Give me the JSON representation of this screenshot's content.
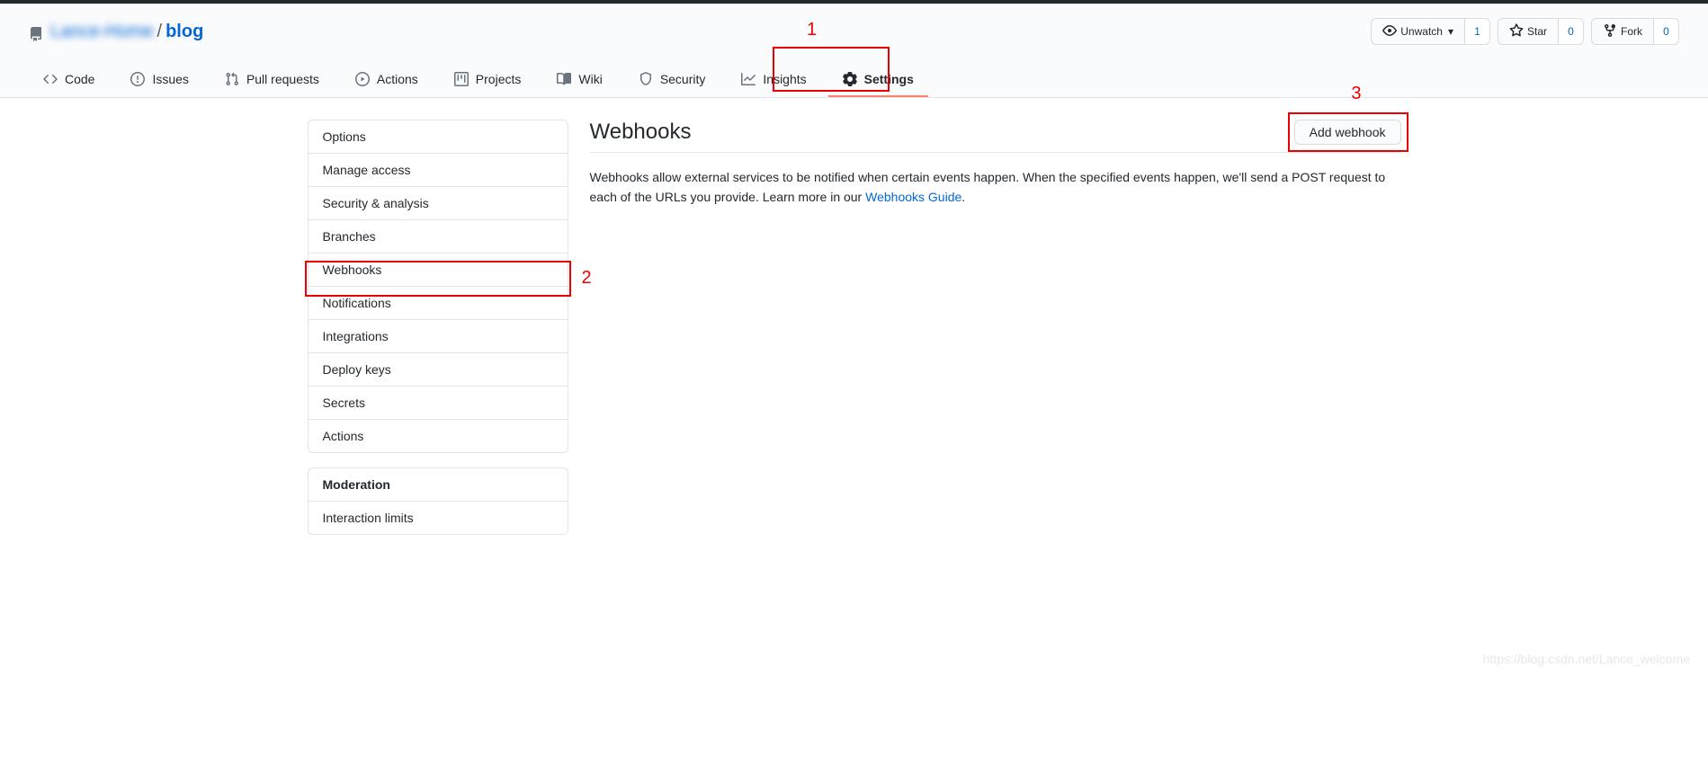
{
  "repo": {
    "owner": "Lance-Home",
    "name": "blog",
    "separator": "/"
  },
  "actions": {
    "watch": {
      "label": "Unwatch",
      "count": "1"
    },
    "star": {
      "label": "Star",
      "count": "0"
    },
    "fork": {
      "label": "Fork",
      "count": "0"
    }
  },
  "tabs": [
    {
      "label": "Code"
    },
    {
      "label": "Issues"
    },
    {
      "label": "Pull requests"
    },
    {
      "label": "Actions"
    },
    {
      "label": "Projects"
    },
    {
      "label": "Wiki"
    },
    {
      "label": "Security"
    },
    {
      "label": "Insights"
    },
    {
      "label": "Settings"
    }
  ],
  "sideMenu1": [
    "Options",
    "Manage access",
    "Security & analysis",
    "Branches",
    "Webhooks",
    "Notifications",
    "Integrations",
    "Deploy keys",
    "Secrets",
    "Actions"
  ],
  "sideMenu2Heading": "Moderation",
  "sideMenu2": [
    "Interaction limits"
  ],
  "main": {
    "heading": "Webhooks",
    "addButton": "Add webhook",
    "descPrefix": "Webhooks allow external services to be notified when certain events happen. When the specified events happen, we'll send a POST request to each of the URLs you provide. Learn more in our ",
    "descLink": "Webhooks Guide",
    "descSuffix": "."
  },
  "annotations": {
    "a1": "1",
    "a2": "2",
    "a3": "3"
  },
  "watermark": "https://blog.csdn.net/Lance_welcome"
}
